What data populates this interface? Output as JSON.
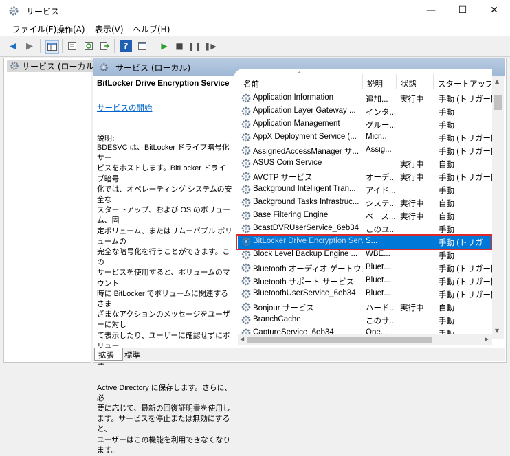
{
  "window": {
    "title": "サービス",
    "minimize": "—",
    "maximize": "☐",
    "close": "✕"
  },
  "menu": [
    "ファイル(F)",
    "操作(A)",
    "表示(V)",
    "ヘルプ(H)"
  ],
  "tree": {
    "item": "サービス (ローカル)"
  },
  "header": {
    "title": "サービス (ローカル)"
  },
  "detail": {
    "service_name": "BitLocker Drive Encryption Service",
    "start_link": "サービスの開始",
    "desc_label": "説明:",
    "desc_text": "BDESVC は、BitLocker ドライブ暗号化サー\nビスをホストします。BitLocker ドライブ暗号\n化では、オペレーティング システムの安全な\nスタートアップ、および OS のボリューム、固\n定ボリューム、またはリムーバブル ボリュームの\n完全な暗号化を行うことができます。この\nサービスを使用すると、ボリュームのマウント\n時に BitLocker でボリュームに関連するさま\nざまなアクションのメッセージをユーザーに対し\nて表示したり、ユーザーに確認せずにボリュー\nムのロックを自動的に解除したりできます。\nまた、回復情報が存在する場合は、\nActive Directory に保存します。さらに、必\n要に応じて、最新の回復証明書を使用し\nます。サービスを停止または無効にすると、\nユーザーはこの機能を利用できなくなります。"
  },
  "columns": {
    "name": "名前",
    "desc": "説明",
    "status": "状態",
    "startup": "スタートアップの種"
  },
  "rows": [
    {
      "name": "Application Information",
      "desc": "追加...",
      "status": "実行中",
      "startup": "手動 (トリガー開"
    },
    {
      "name": "Application Layer Gateway ...",
      "desc": "インタ...",
      "status": "",
      "startup": "手動"
    },
    {
      "name": "Application Management",
      "desc": "グルー...",
      "status": "",
      "startup": "手動"
    },
    {
      "name": "AppX Deployment Service (...",
      "desc": "Micr...",
      "status": "",
      "startup": "手動 (トリガー開"
    },
    {
      "name": "AssignedAccessManager サ...",
      "desc": "Assig...",
      "status": "",
      "startup": "手動 (トリガー開"
    },
    {
      "name": "ASUS Com Service",
      "desc": "",
      "status": "実行中",
      "startup": "自動"
    },
    {
      "name": "AVCTP サービス",
      "desc": "オーデ...",
      "status": "実行中",
      "startup": "手動 (トリガー開"
    },
    {
      "name": "Background Intelligent Tran...",
      "desc": "アイド...",
      "status": "",
      "startup": "手動"
    },
    {
      "name": "Background Tasks Infrastruc...",
      "desc": "システ...",
      "status": "実行中",
      "startup": "自動"
    },
    {
      "name": "Base Filtering Engine",
      "desc": "ベース...",
      "status": "実行中",
      "startup": "自動"
    },
    {
      "name": "BcastDVRUserService_6eb34",
      "desc": "このユ...",
      "status": "",
      "startup": "手動"
    },
    {
      "name": "BitLocker Drive Encryption Service",
      "desc": "S...",
      "status": "",
      "startup": "手動 (トリガー開"
    },
    {
      "name": "Block Level Backup Engine ...",
      "desc": "WBE...",
      "status": "",
      "startup": "手動"
    },
    {
      "name": "Bluetooth オーディオ ゲートウェ...",
      "desc": "Bluet...",
      "status": "",
      "startup": "手動 (トリガー開"
    },
    {
      "name": "Bluetooth サポート サービス",
      "desc": "Bluet...",
      "status": "",
      "startup": "手動 (トリガー開"
    },
    {
      "name": "BluetoothUserService_6eb34",
      "desc": "Bluet...",
      "status": "",
      "startup": "手動 (トリガー開"
    },
    {
      "name": "Bonjour サービス",
      "desc": "ハード...",
      "status": "実行中",
      "startup": "自動"
    },
    {
      "name": "BranchCache",
      "desc": "このサ...",
      "status": "",
      "startup": "手動"
    },
    {
      "name": "CaptureService_6eb34",
      "desc": "One...",
      "status": "",
      "startup": "手動"
    }
  ],
  "tabs": [
    "拡張",
    "標準"
  ]
}
